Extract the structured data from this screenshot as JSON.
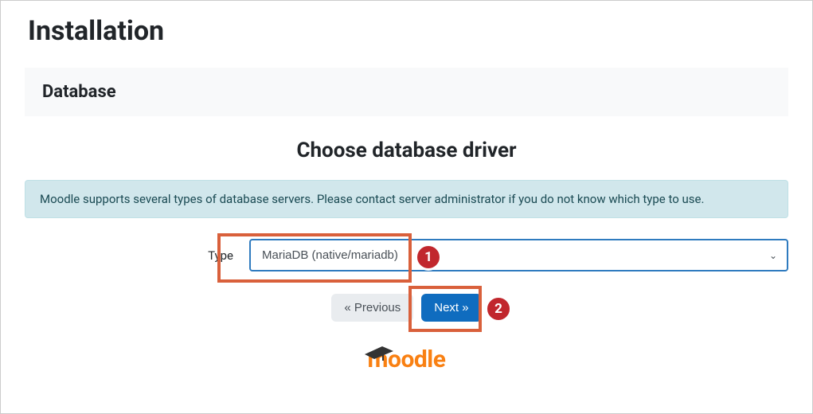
{
  "page": {
    "title": "Installation"
  },
  "section": {
    "heading": "Database"
  },
  "form": {
    "heading": "Choose database driver",
    "info": "Moodle supports several types of database servers. Please contact server administrator if you do not know which type to use.",
    "type_label": "Type",
    "selected_option": "MariaDB (native/mariadb)"
  },
  "buttons": {
    "previous": "« Previous",
    "next": "Next »"
  },
  "logo": {
    "text": "moodle"
  },
  "annotations": {
    "callout1": "1",
    "callout2": "2"
  }
}
